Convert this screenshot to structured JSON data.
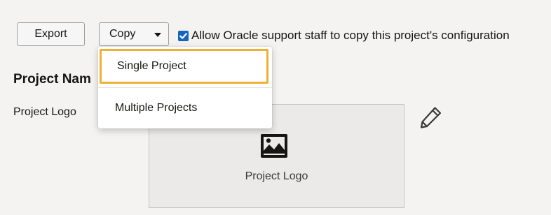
{
  "toolbar": {
    "export_label": "Export",
    "copy_label": "Copy",
    "allow_support_checkbox": {
      "checked": true,
      "label": "Allow Oracle support staff to copy this project's configuration"
    }
  },
  "copy_menu": {
    "items": [
      {
        "label": "Single Project",
        "focused": true
      },
      {
        "label": "Multiple Projects",
        "focused": false
      }
    ]
  },
  "project": {
    "name_label": "Project Nam",
    "logo_label": "Project Logo",
    "logo_placeholder": "Project Logo"
  },
  "icons": {
    "edit": "pencil-icon",
    "logo_image": "image-icon",
    "dropdown": "caret-down-icon",
    "checkbox": "checkmark-icon"
  },
  "colors": {
    "focus_ring": "#f0b035",
    "checkbox": "#1565c0",
    "background": "#f4f3f2"
  }
}
